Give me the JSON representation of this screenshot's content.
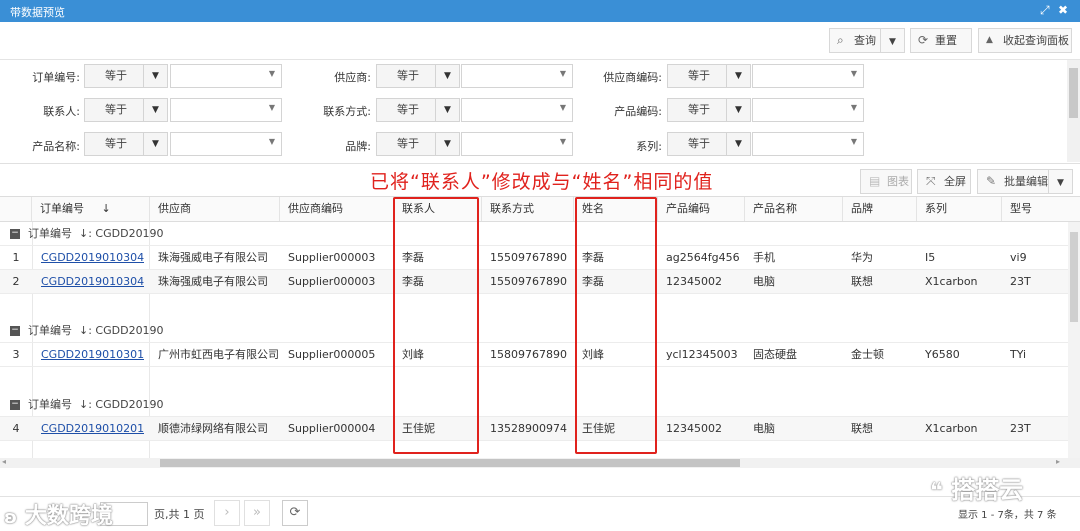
{
  "window": {
    "title": "带数据预览"
  },
  "toolbar": {
    "query": "查询",
    "reset": "重置",
    "collapse": "收起查询面板"
  },
  "filters": [
    {
      "label": "订单编号:",
      "op": "等于"
    },
    {
      "label": "供应商:",
      "op": "等于"
    },
    {
      "label": "供应商编码:",
      "op": "等于"
    },
    {
      "label": "联系人:",
      "op": "等于"
    },
    {
      "label": "联系方式:",
      "op": "等于"
    },
    {
      "label": "产品编码:",
      "op": "等于"
    },
    {
      "label": "产品名称:",
      "op": "等于"
    },
    {
      "label": "品牌:",
      "op": "等于"
    },
    {
      "label": "系列:",
      "op": "等于"
    }
  ],
  "annotation": "已将“联系人”修改成与“姓名”相同的值",
  "grid_toolbar": {
    "chart": "图表",
    "fullscreen": "全屏",
    "batch_edit": "批量编辑"
  },
  "columns": [
    "订单编号",
    "供应商",
    "供应商编码",
    "联系人",
    "联系方式",
    "姓名",
    "产品编码",
    "产品名称",
    "品牌",
    "系列",
    "型号"
  ],
  "groups": [
    {
      "label": "订单编号",
      "value": "↓: CGDD20190"
    },
    {
      "label": "订单编号",
      "value": "↓: CGDD20190"
    },
    {
      "label": "订单编号",
      "value": "↓: CGDD20190"
    }
  ],
  "rows": [
    {
      "n": "1",
      "order": "CGDD2019010304",
      "supplier": "珠海强威电子有限公司",
      "supplier_code": "Supplier000003",
      "contact": "李磊",
      "phone": "15509767890",
      "name": "李磊",
      "product_code": "ag2564fg456",
      "product_name": "手机",
      "brand": "华为",
      "series": "I5",
      "model": "vi9"
    },
    {
      "n": "2",
      "order": "CGDD2019010304",
      "supplier": "珠海强威电子有限公司",
      "supplier_code": "Supplier000003",
      "contact": "李磊",
      "phone": "15509767890",
      "name": "李磊",
      "product_code": "12345002",
      "product_name": "电脑",
      "brand": "联想",
      "series": "X1carbon",
      "model": "23T"
    },
    {
      "n": "3",
      "order": "CGDD2019010301",
      "supplier": "广州市虹西电子有限公司",
      "supplier_code": "Supplier000005",
      "contact": "刘峰",
      "phone": "15809767890",
      "name": "刘峰",
      "product_code": "ycl12345003",
      "product_name": "固态硬盘",
      "brand": "金士顿",
      "series": "Y6580",
      "model": "TYi"
    },
    {
      "n": "4",
      "order": "CGDD2019010201",
      "supplier": "顺德沛绿网络有限公司",
      "supplier_code": "Supplier000004",
      "contact": "王佳妮",
      "phone": "13528900974",
      "name": "王佳妮",
      "product_code": "12345002",
      "product_name": "电脑",
      "brand": "联想",
      "series": "X1carbon",
      "model": "23T"
    }
  ],
  "pagination": {
    "page_input": "",
    "total_pages": "页,共 1 页",
    "summary": "显示 1 - 7条，共 7 条"
  },
  "watermarks": {
    "left": "大数跨境",
    "right": "搭搭云"
  },
  "colors": {
    "titlebar": "#3a8fd6",
    "annotation": "#e0221d",
    "link": "#1e4fa8"
  }
}
